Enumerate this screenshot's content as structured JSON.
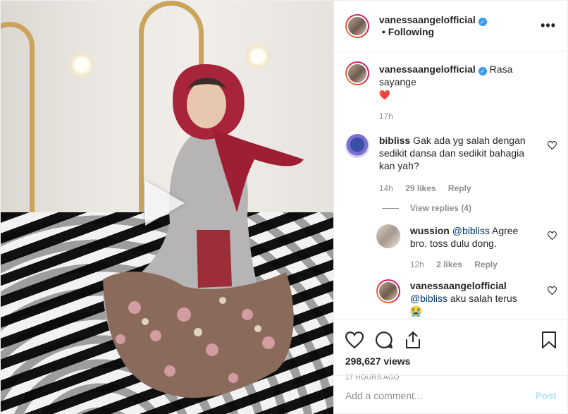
{
  "header": {
    "username": "vanessaangelofficial",
    "separator": "•",
    "follow_label": "Following",
    "more_label": "•••"
  },
  "caption": {
    "username": "vanessaangelofficial",
    "text": "Rasa sayange",
    "emoji": "❤️",
    "time": "17h"
  },
  "comments": [
    {
      "username": "bibliss",
      "text": "Gak ada yg salah dengan sedikit dansa dan sedikit bahagia kan yah?",
      "time": "14h",
      "likes": "29 likes",
      "reply_label": "Reply",
      "view_replies": "View replies (4)",
      "replies": [
        {
          "username": "wussion",
          "mention": "@bibliss",
          "text": "Agree bro. toss dulu dong.",
          "time": "12h",
          "likes": "2 likes",
          "reply_label": "Reply"
        },
        {
          "username": "vanessaangelofficial",
          "mention": "@bibliss",
          "text": "aku salah terus",
          "emoji": "😭"
        }
      ]
    }
  ],
  "stats": {
    "views": "298,627 views",
    "ago": "17 HOURS AGO"
  },
  "composer": {
    "placeholder": "Add a comment...",
    "post_label": "Post"
  },
  "colors": {
    "verified": "#3897f0",
    "secondary_text": "#8e8e8e",
    "post_button": "#b2dffc",
    "mention": "#003569"
  },
  "icons": [
    "verified-badge-icon",
    "like-icon",
    "comment-icon",
    "share-icon",
    "bookmark-icon",
    "play-icon",
    "heart-small-icon"
  ]
}
